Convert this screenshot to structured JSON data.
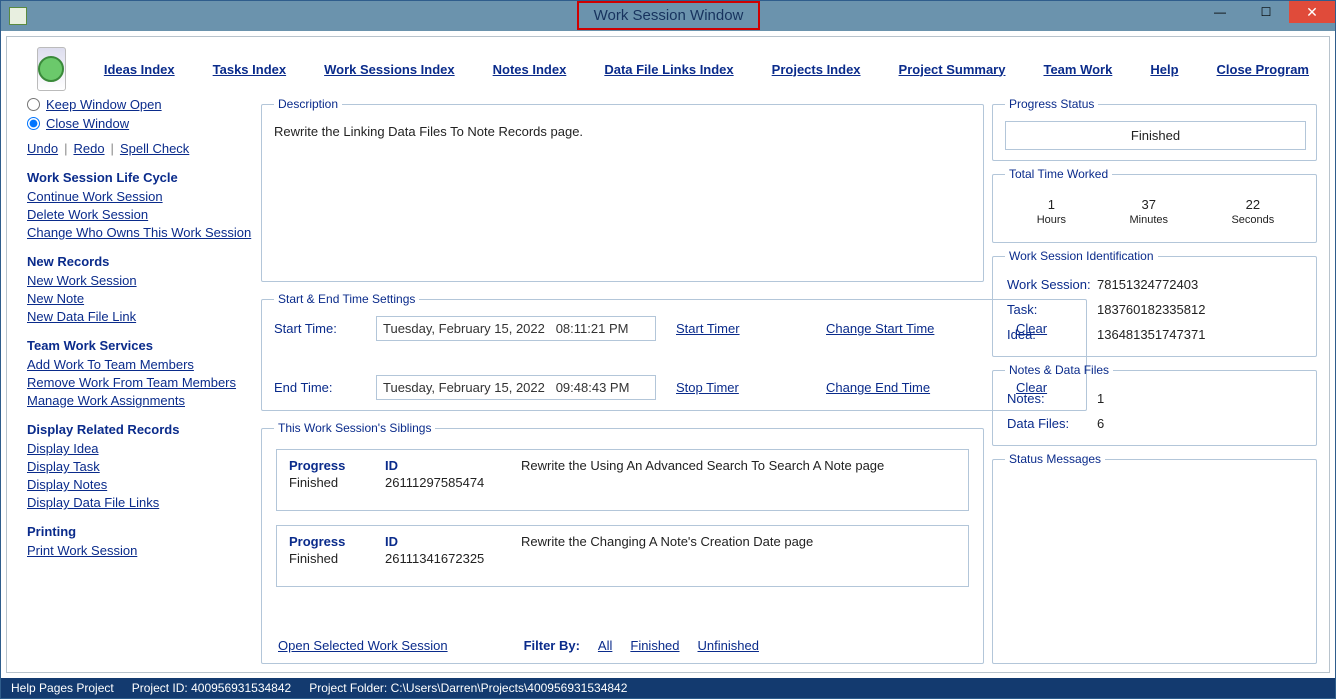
{
  "window_title": "Work Session Window",
  "toolbar": {
    "ideas_index": "Ideas Index",
    "tasks_index": "Tasks Index",
    "work_sessions_index": "Work Sessions Index",
    "notes_index": "Notes Index",
    "data_file_links_index": "Data File Links Index",
    "projects_index": "Projects Index",
    "project_summary": "Project Summary",
    "team_work": "Team Work",
    "help": "Help",
    "close_program": "Close Program"
  },
  "window_options": {
    "keep_open": "Keep Window Open",
    "close": "Close Window"
  },
  "left_actions": {
    "undo": "Undo",
    "redo": "Redo",
    "spell_check": "Spell Check"
  },
  "left_groups": {
    "lifecycle": {
      "title": "Work Session Life Cycle",
      "continue": "Continue Work Session",
      "delete": "Delete Work Session",
      "change_owner": "Change Who Owns This Work Session"
    },
    "new_records": {
      "title": "New Records",
      "new_ws": "New Work Session",
      "new_note": "New Note",
      "new_dfl": "New Data File Link"
    },
    "team": {
      "title": "Team Work Services",
      "add": "Add Work To Team Members",
      "remove": "Remove Work From Team Members",
      "manage": "Manage Work Assignments"
    },
    "display": {
      "title": "Display Related Records",
      "idea": "Display Idea",
      "task": "Display Task",
      "notes": "Display Notes",
      "dfl": "Display Data File Links"
    },
    "printing": {
      "title": "Printing",
      "print": "Print Work Session"
    }
  },
  "center": {
    "description_legend": "Description",
    "description_text": "Rewrite the Linking Data Files To Note Records page.",
    "time_legend": "Start & End Time Settings",
    "start_label": "Start Time:",
    "end_label": "End Time:",
    "start_value": "Tuesday, February 15, 2022   08:11:21 PM",
    "end_value": "Tuesday, February 15, 2022   09:48:43 PM",
    "start_timer": "Start Timer",
    "change_start": "Change Start Time",
    "clear_start": "Clear",
    "stop_timer": "Stop Timer",
    "change_end": "Change End Time",
    "clear_end": "Clear",
    "siblings_legend": "This Work Session's Siblings",
    "col_progress": "Progress",
    "col_id": "ID",
    "siblings": [
      {
        "progress": "Finished",
        "id": "26111297585474",
        "text": "Rewrite the Using An Advanced Search To Search A Note page"
      },
      {
        "progress": "Finished",
        "id": "26111341672325",
        "text": "Rewrite the Changing A Note's Creation Date page"
      }
    ],
    "open_selected": "Open Selected Work Session",
    "filter_by_label": "Filter By:",
    "filter_all": "All",
    "filter_finished": "Finished",
    "filter_unfinished": "Unfinished"
  },
  "right": {
    "progress_legend": "Progress Status",
    "progress_value": "Finished",
    "time_worked_legend": "Total Time Worked",
    "hours_val": "1",
    "hours_lab": "Hours",
    "minutes_val": "37",
    "minutes_lab": "Minutes",
    "seconds_val": "22",
    "seconds_lab": "Seconds",
    "id_legend": "Work Session Identification",
    "ws_label": "Work Session:",
    "ws_val": "78151324772403",
    "task_label": "Task:",
    "task_val": "183760182335812",
    "idea_label": "Idea:",
    "idea_val": "136481351747371",
    "notesfiles_legend": "Notes & Data Files",
    "notes_label": "Notes:",
    "notes_val": "1",
    "files_label": "Data Files:",
    "files_val": "6",
    "status_legend": "Status Messages"
  },
  "statusbar": {
    "project_name": "Help Pages Project",
    "project_id_label": "Project ID:",
    "project_id": "400956931534842",
    "project_folder_label": "Project Folder:",
    "project_folder": "C:\\Users\\Darren\\Projects\\400956931534842"
  }
}
